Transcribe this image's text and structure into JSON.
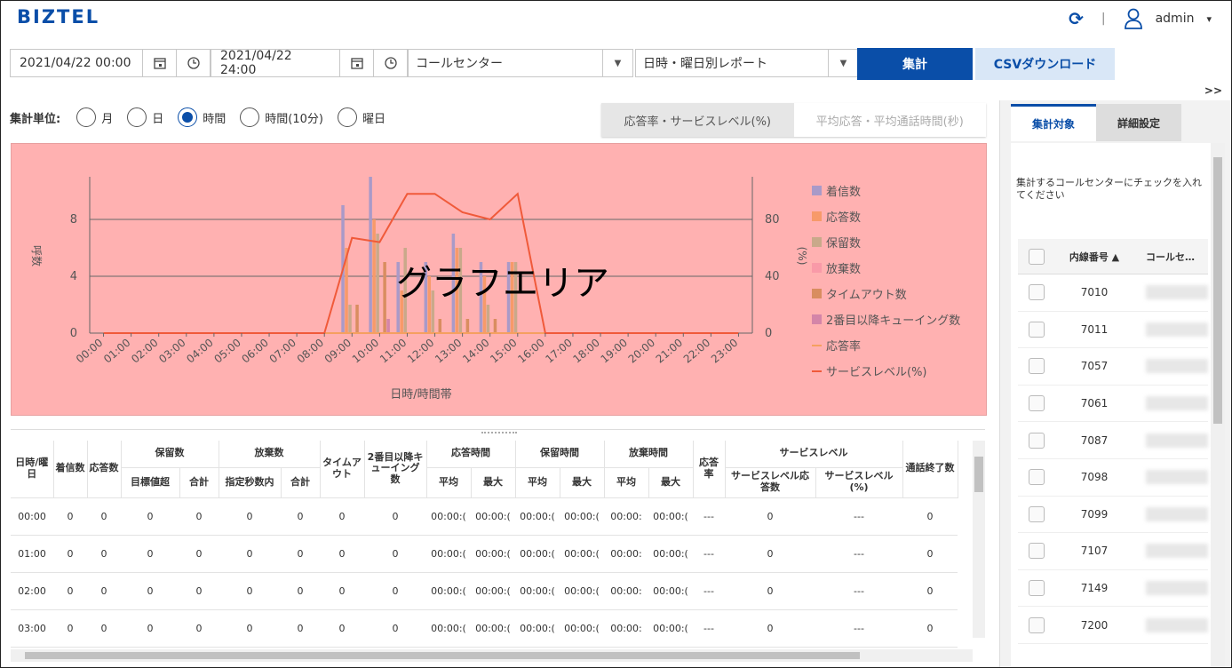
{
  "app": {
    "logo": "BIZTEL"
  },
  "header": {
    "separator": "|",
    "user": "admin",
    "caret": "▾"
  },
  "toolbar": {
    "start_datetime": "2021/04/22 00:00",
    "end_datetime": "2021/04/22 24:00",
    "center_select": "コールセンター",
    "report_select": "日時・曜日別レポート",
    "aggregate_label": "集計",
    "csv_label": "CSVダウンロード",
    "expand_label": ">>"
  },
  "unit": {
    "label": "集計単位:",
    "options": [
      "月",
      "日",
      "時間",
      "時間(10分)",
      "曜日"
    ],
    "selected": "時間"
  },
  "chart_tabs": [
    "応答率・サービスレベル(%)",
    "平均応答・平均通話時間(秒)"
  ],
  "chart_overlay": "グラフエリア",
  "chart_data": {
    "type": "bar",
    "categories": [
      "00:00",
      "01:00",
      "02:00",
      "03:00",
      "04:00",
      "05:00",
      "06:00",
      "07:00",
      "08:00",
      "09:00",
      "10:00",
      "11:00",
      "12:00",
      "13:00",
      "14:00",
      "15:00",
      "16:00",
      "17:00",
      "18:00",
      "19:00",
      "20:00",
      "21:00",
      "22:00",
      "23:00"
    ],
    "xlabel": "日時/時間帯",
    "ylabel": "呼数",
    "y2label": "(%)",
    "ylim": [
      0,
      11
    ],
    "y2lim": [
      0,
      110
    ],
    "yticks": [
      "0",
      "4",
      "8"
    ],
    "y2ticks": [
      "0",
      "40",
      "80"
    ],
    "legend_position": "right",
    "series": [
      {
        "name": "着信数",
        "color": "#a99ac8",
        "values": [
          0,
          0,
          0,
          0,
          0,
          0,
          0,
          0,
          0,
          9,
          11,
          5,
          5,
          7,
          5,
          5,
          0,
          0,
          0,
          0,
          0,
          0,
          0,
          0
        ]
      },
      {
        "name": "応答数",
        "color": "#f79a6a",
        "values": [
          0,
          0,
          0,
          0,
          0,
          0,
          0,
          0,
          0,
          6,
          8,
          3,
          4,
          6,
          4,
          5,
          0,
          0,
          0,
          0,
          0,
          0,
          0,
          0
        ]
      },
      {
        "name": "保留数",
        "color": "#c9a98a",
        "values": [
          0,
          0,
          0,
          0,
          0,
          0,
          0,
          0,
          0,
          2,
          7,
          6,
          3,
          6,
          2,
          5,
          0,
          0,
          0,
          0,
          0,
          0,
          0,
          0
        ]
      },
      {
        "name": "放棄数",
        "color": "#f99aa8",
        "values": [
          0,
          0,
          0,
          0,
          0,
          0,
          0,
          0,
          0,
          0,
          0,
          0,
          0,
          0,
          0,
          0,
          0,
          0,
          0,
          0,
          0,
          0,
          0,
          0
        ]
      },
      {
        "name": "タイムアウト数",
        "color": "#d98d60",
        "values": [
          0,
          0,
          0,
          0,
          0,
          0,
          0,
          0,
          0,
          2,
          5,
          0,
          1,
          1,
          1,
          0,
          0,
          0,
          0,
          0,
          0,
          0,
          0,
          0
        ]
      },
      {
        "name": "2番目以降キューイング数",
        "color": "#d485a8",
        "values": [
          0,
          0,
          0,
          0,
          0,
          0,
          0,
          0,
          0,
          0,
          1,
          0,
          0,
          0,
          0,
          0,
          0,
          0,
          0,
          0,
          0,
          0,
          0,
          0
        ]
      }
    ],
    "lines": [
      {
        "name": "応答率",
        "color": "#f5a060",
        "values": [
          0,
          0,
          0,
          0,
          0,
          0,
          0,
          0,
          0,
          0,
          0,
          0,
          0,
          0,
          0,
          0,
          0,
          0,
          0,
          0,
          0,
          0,
          0,
          0
        ]
      },
      {
        "name": "サービスレベル(%)",
        "color": "#f05a3a",
        "values": [
          0,
          0,
          0,
          0,
          0,
          0,
          0,
          0,
          0,
          67,
          64,
          98,
          98,
          85,
          80,
          98,
          0,
          0,
          0,
          0,
          0,
          0,
          0,
          0
        ]
      }
    ]
  },
  "table": {
    "group_headers": [
      "保留数",
      "放棄数",
      "応答時間",
      "保留時間",
      "放棄時間",
      "サービスレベル"
    ],
    "cols": {
      "datetime": "日時/曜日",
      "incoming": "着信数",
      "answered": "応答数",
      "hold_over": "目標値超",
      "hold_total": "合計",
      "abandon_in": "指定秒数内",
      "abandon_total": "合計",
      "timeout": "タイムアウト",
      "queue2": "2番目以降キューイング数",
      "resp_avg": "平均",
      "resp_max": "最大",
      "hold_avg": "平均",
      "hold_max": "最大",
      "ab_avg": "平均",
      "ab_max": "最大",
      "resp_rate": "応答率",
      "sl_count": "サービスレベル応答数",
      "sl_pct": "サービスレベル(%)",
      "call_end": "通話終了数"
    },
    "rows": [
      [
        "00:00",
        "0",
        "0",
        "0",
        "0",
        "0",
        "0",
        "0",
        "0",
        "00:00:(",
        "00:00:(",
        "00:00:(",
        "00:00:(",
        "00:00:",
        "00:00:(",
        "---",
        "0",
        "---",
        "0"
      ],
      [
        "01:00",
        "0",
        "0",
        "0",
        "0",
        "0",
        "0",
        "0",
        "0",
        "00:00:(",
        "00:00:(",
        "00:00:(",
        "00:00:(",
        "00:00:",
        "00:00:(",
        "---",
        "0",
        "---",
        "0"
      ],
      [
        "02:00",
        "0",
        "0",
        "0",
        "0",
        "0",
        "0",
        "0",
        "0",
        "00:00:(",
        "00:00:(",
        "00:00:(",
        "00:00:(",
        "00:00:",
        "00:00:(",
        "---",
        "0",
        "---",
        "0"
      ],
      [
        "03:00",
        "0",
        "0",
        "0",
        "0",
        "0",
        "0",
        "0",
        "0",
        "00:00:(",
        "00:00:(",
        "00:00:(",
        "00:00:(",
        "00:00:",
        "00:00:(",
        "---",
        "0",
        "---",
        "0"
      ]
    ]
  },
  "right_panel": {
    "tabs": [
      "集計対象",
      "詳細設定"
    ],
    "description": "集計するコールセンターにチェックを入れてください",
    "col_ext": "内線番号",
    "col_name": "コールセ…",
    "rows": [
      "7010",
      "7011",
      "7057",
      "7061",
      "7087",
      "7098",
      "7099",
      "7107",
      "7149",
      "7200"
    ]
  }
}
